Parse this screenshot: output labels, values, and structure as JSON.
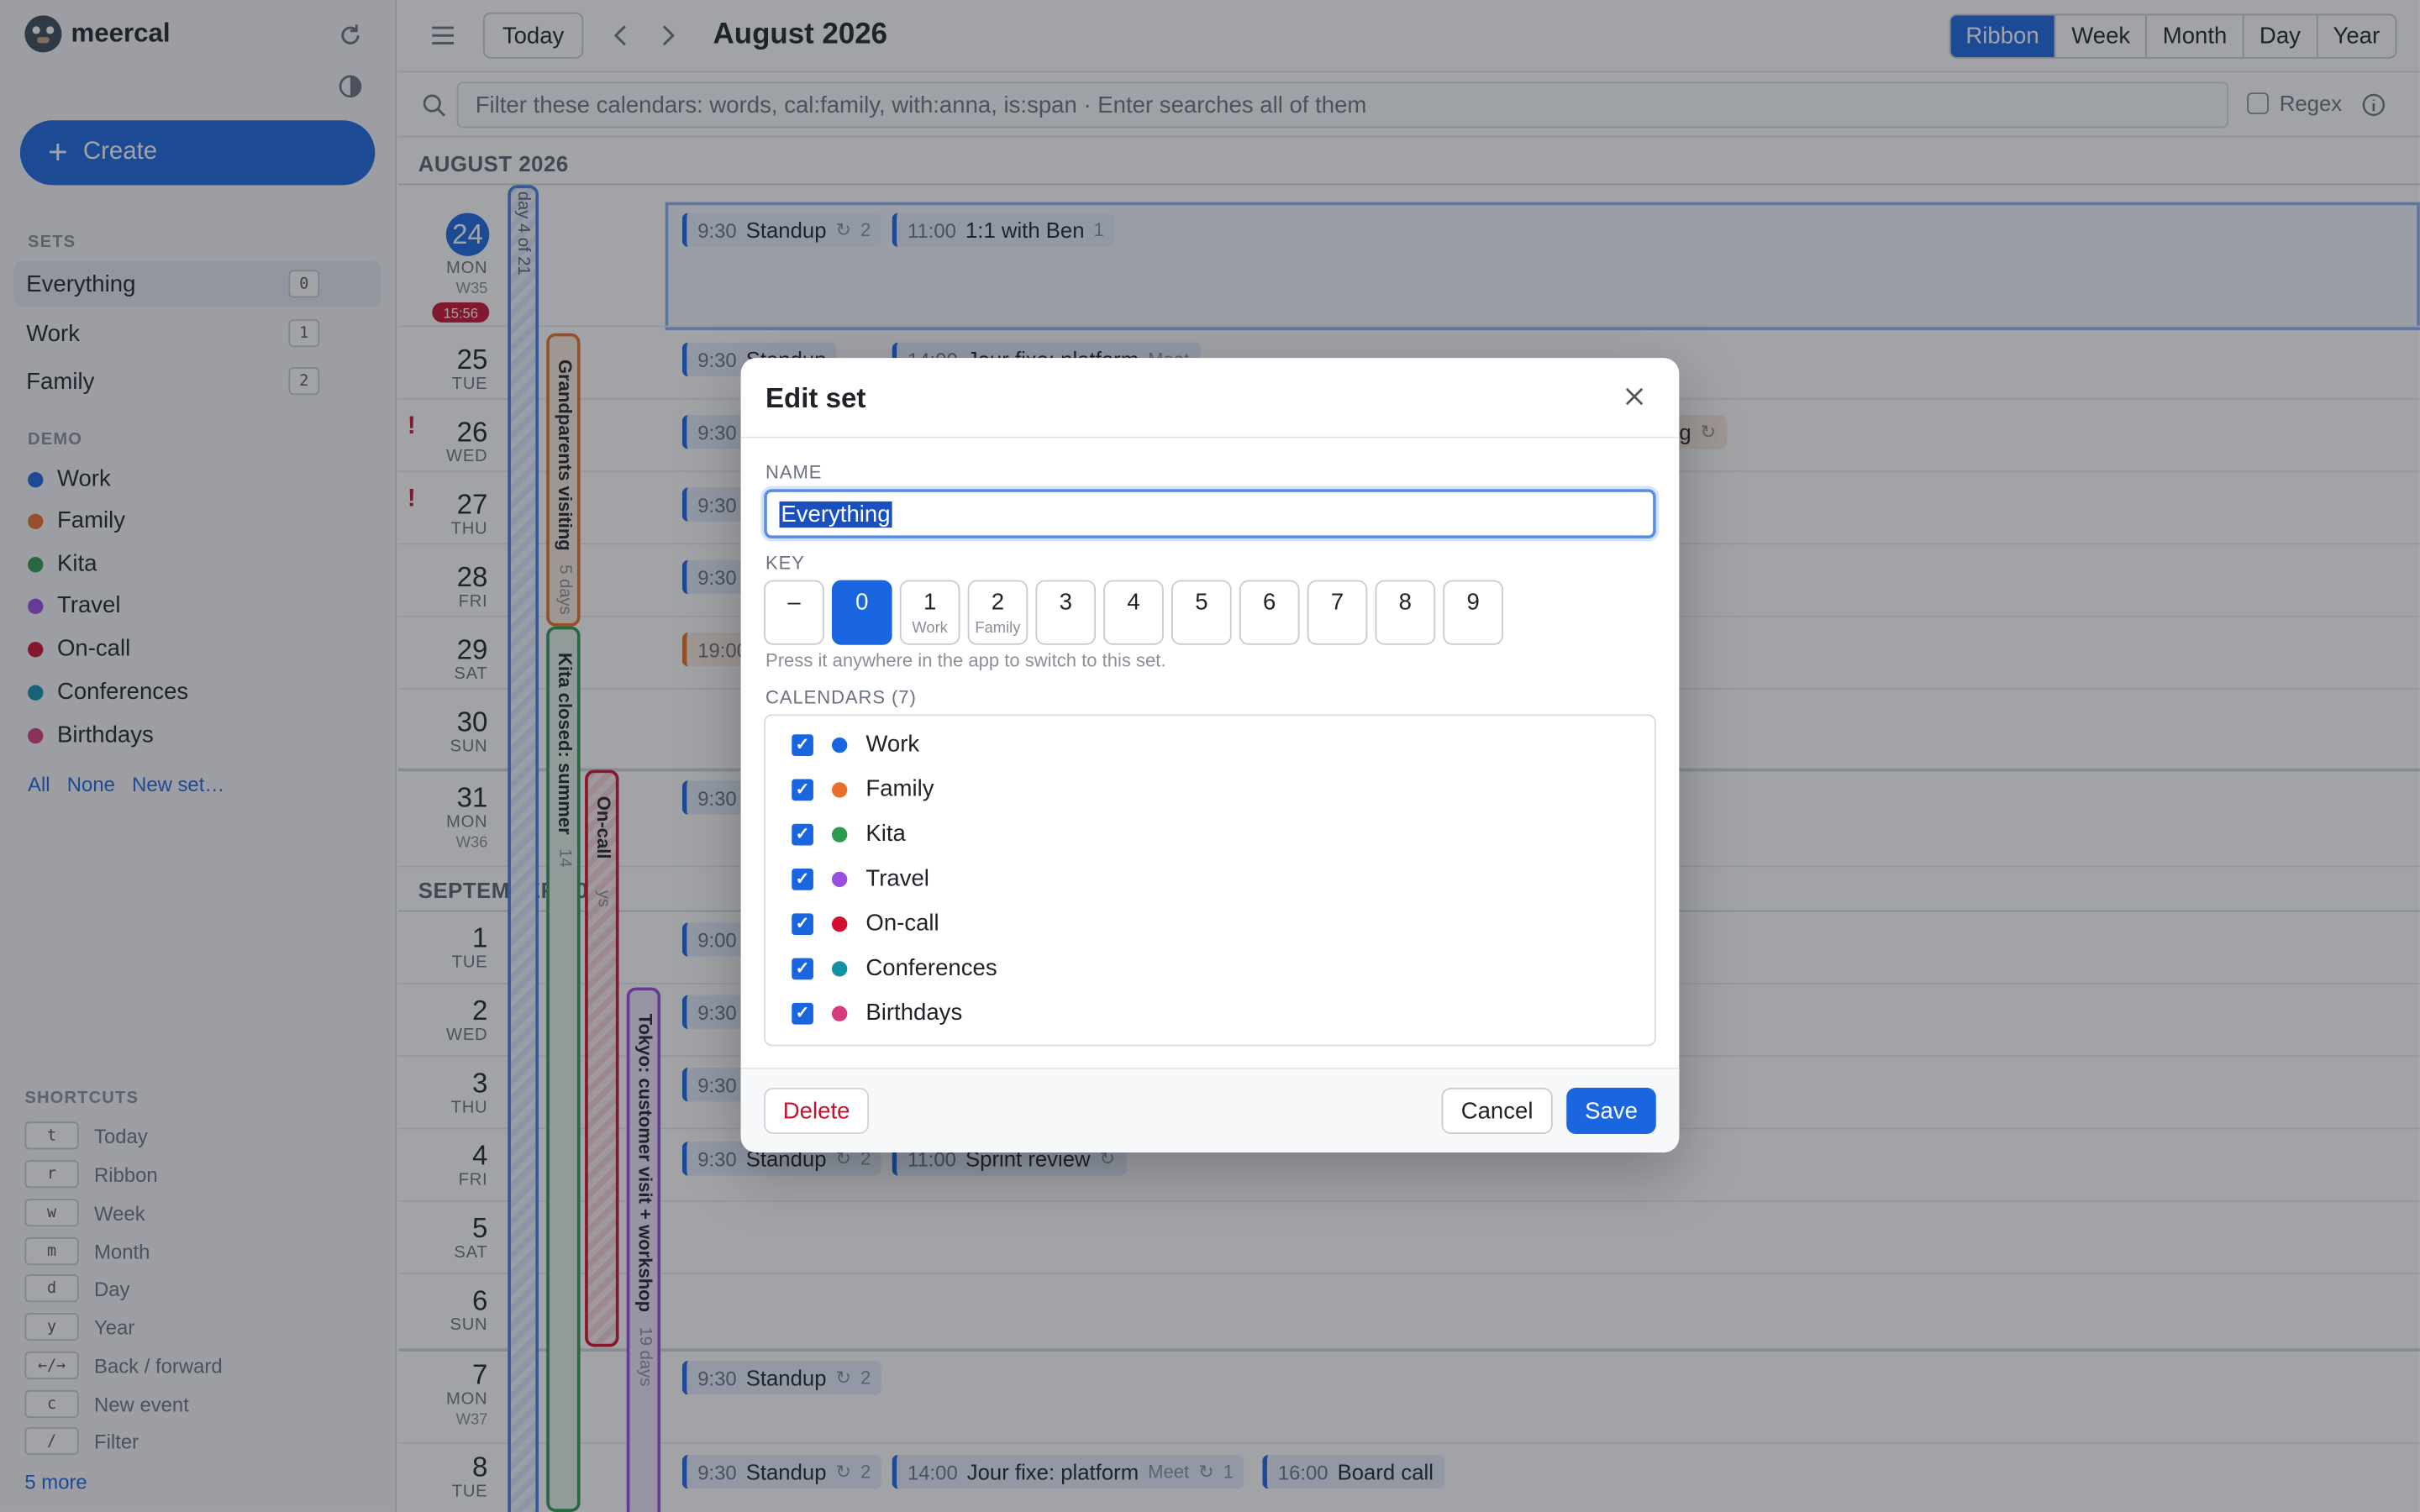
{
  "app": {
    "name": "meercal"
  },
  "sidebar": {
    "create_label": "Create",
    "sets_label": "SETS",
    "sets": [
      {
        "label": "Everything",
        "key": "0"
      },
      {
        "label": "Work",
        "key": "1"
      },
      {
        "label": "Family",
        "key": "2"
      }
    ],
    "demo_label": "DEMO",
    "calendars": [
      {
        "label": "Work",
        "color": "#1a66e0"
      },
      {
        "label": "Family",
        "color": "#e8702a"
      },
      {
        "label": "Kita",
        "color": "#2e9a4e"
      },
      {
        "label": "Travel",
        "color": "#9b4de0"
      },
      {
        "label": "On-call",
        "color": "#d0102e"
      },
      {
        "label": "Conferences",
        "color": "#1290a8"
      },
      {
        "label": "Birthdays",
        "color": "#d63a7f"
      }
    ],
    "links": {
      "all": "All",
      "none": "None",
      "new_set": "New set…"
    },
    "shortcuts_label": "SHORTCUTS",
    "shortcuts": [
      {
        "key": "t",
        "label": "Today"
      },
      {
        "key": "r",
        "label": "Ribbon"
      },
      {
        "key": "w",
        "label": "Week"
      },
      {
        "key": "m",
        "label": "Month"
      },
      {
        "key": "d",
        "label": "Day"
      },
      {
        "key": "y",
        "label": "Year"
      },
      {
        "key": "←/→",
        "label": "Back / forward"
      },
      {
        "key": "c",
        "label": "New event"
      },
      {
        "key": "/",
        "label": "Filter"
      }
    ],
    "more_link": "5 more"
  },
  "toolbar": {
    "today": "Today",
    "title": "August 2026",
    "views": [
      "Ribbon",
      "Week",
      "Month",
      "Day",
      "Year"
    ],
    "active_view": "Ribbon"
  },
  "filter": {
    "placeholder": "Filter these calendars: words, cal:family, with:anna, is:span · Enter searches all of them",
    "regex_label": "Regex"
  },
  "calendar": {
    "month1": "AUGUST 2026",
    "month2": "SEPTEMBER 2026",
    "now_time": "15:56",
    "days": [
      {
        "num": "24",
        "name": "MON",
        "week": "W35"
      },
      {
        "num": "25",
        "name": "TUE"
      },
      {
        "num": "26",
        "name": "WED"
      },
      {
        "num": "27",
        "name": "THU"
      },
      {
        "num": "28",
        "name": "FRI"
      },
      {
        "num": "29",
        "name": "SAT"
      },
      {
        "num": "30",
        "name": "SUN"
      },
      {
        "num": "31",
        "name": "MON",
        "week": "W36"
      },
      {
        "num": "1",
        "name": "TUE"
      },
      {
        "num": "2",
        "name": "WED"
      },
      {
        "num": "3",
        "name": "THU"
      },
      {
        "num": "4",
        "name": "FRI"
      },
      {
        "num": "5",
        "name": "SAT"
      },
      {
        "num": "6",
        "name": "SUN"
      },
      {
        "num": "7",
        "name": "MON",
        "week": "W37"
      },
      {
        "num": "8",
        "name": "TUE"
      }
    ],
    "bands": {
      "work_span": "day 4 of 21",
      "grandparents": "Grandparents visiting",
      "grandparents_len": "5 days",
      "kita": "Kita closed: summer",
      "kita_len": "14",
      "oncall": "On-call",
      "oncall_len": "ys",
      "tokyo": "Tokyo: customer visit + workshop",
      "tokyo_len": "19 days"
    },
    "events": {
      "standup_time": "9:30",
      "standup": "Standup",
      "standup_count": "2",
      "oneonone_time": "11:00",
      "oneonone": "1:1 with Ben",
      "oneonone_count": "1",
      "jour_time": "14:00",
      "jour": "Jour fixe: platform",
      "jour_meet": "Meet",
      "jour_count": "1",
      "evening_time": "19:00",
      "sept1_time": "9:00",
      "review_time": "11:00",
      "review": "Sprint review",
      "board_time": "16:00",
      "board": "Board call",
      "partial_g": "g"
    }
  },
  "modal": {
    "title": "Edit set",
    "name_label": "NAME",
    "name_value": "Everything",
    "key_label": "KEY",
    "keys": [
      {
        "label": "–",
        "sub": ""
      },
      {
        "label": "0",
        "sub": ""
      },
      {
        "label": "1",
        "sub": "Work"
      },
      {
        "label": "2",
        "sub": "Family"
      },
      {
        "label": "3",
        "sub": ""
      },
      {
        "label": "4",
        "sub": ""
      },
      {
        "label": "5",
        "sub": ""
      },
      {
        "label": "6",
        "sub": ""
      },
      {
        "label": "7",
        "sub": ""
      },
      {
        "label": "8",
        "sub": ""
      },
      {
        "label": "9",
        "sub": ""
      }
    ],
    "selected_key": "0",
    "key_hint": "Press it anywhere in the app to switch to this set.",
    "calendars_label": "CALENDARS (7)",
    "calendars": [
      {
        "label": "Work",
        "checked": true,
        "color": "#1a66e0"
      },
      {
        "label": "Family",
        "checked": true,
        "color": "#e8702a"
      },
      {
        "label": "Kita",
        "checked": true,
        "color": "#2e9a4e"
      },
      {
        "label": "Travel",
        "checked": true,
        "color": "#9b4de0"
      },
      {
        "label": "On-call",
        "checked": true,
        "color": "#d0102e"
      },
      {
        "label": "Conferences",
        "checked": true,
        "color": "#1290a8"
      },
      {
        "label": "Birthdays",
        "checked": true,
        "color": "#d63a7f"
      }
    ],
    "delete_label": "Delete",
    "cancel_label": "Cancel",
    "save_label": "Save"
  }
}
